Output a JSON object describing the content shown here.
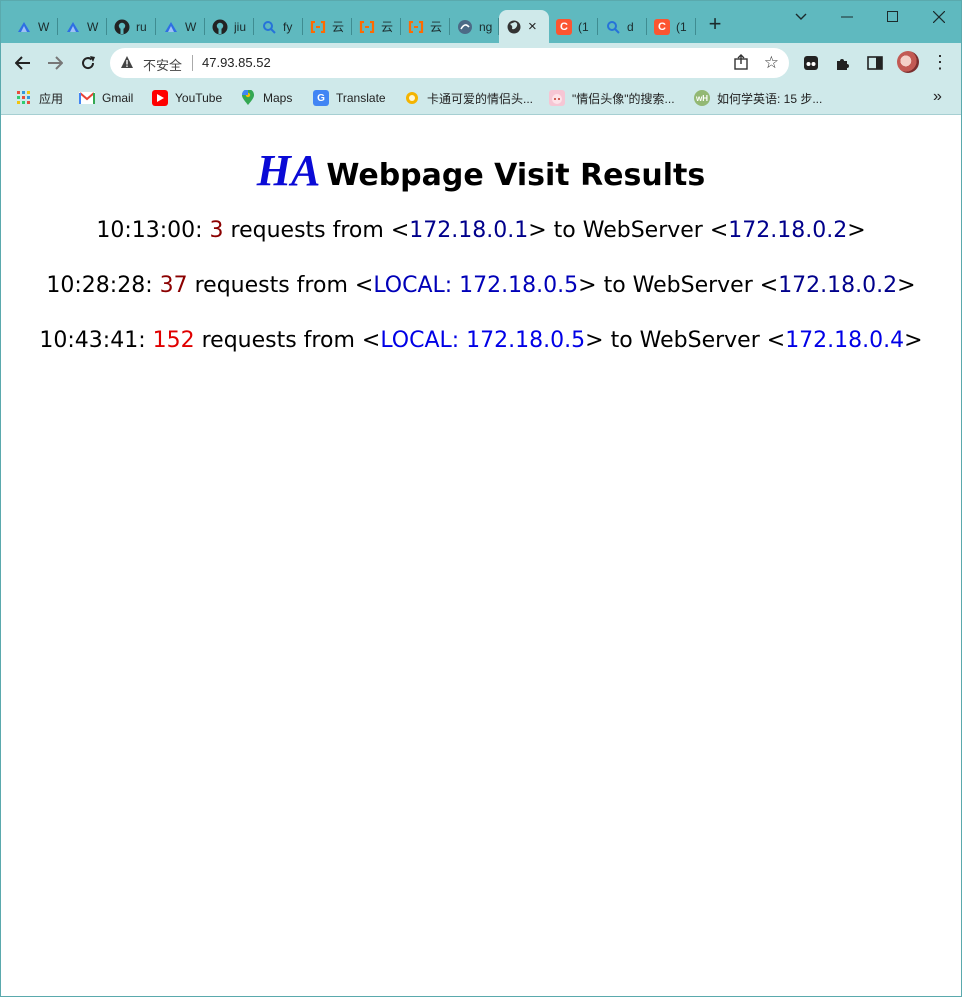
{
  "browser": {
    "tabs": [
      {
        "label": "W",
        "icon": "triangle-logo-icon",
        "color": "#2e6fe3"
      },
      {
        "label": "W",
        "icon": "triangle-logo-icon",
        "color": "#2e6fe3"
      },
      {
        "label": "ru",
        "icon": "github-icon",
        "color": "#222222"
      },
      {
        "label": "W",
        "icon": "triangle-logo-icon",
        "color": "#2e6fe3"
      },
      {
        "label": "jiu",
        "icon": "github-icon",
        "color": "#222222"
      },
      {
        "label": "fy",
        "icon": "search-icon",
        "color": "#2673d9"
      },
      {
        "label": "云",
        "icon": "aliyun-icon",
        "color": "#ff6a00"
      },
      {
        "label": "云",
        "icon": "aliyun-icon",
        "color": "#ff6a00"
      },
      {
        "label": "云",
        "icon": "aliyun-icon",
        "color": "#ff6a00"
      },
      {
        "label": "ng",
        "icon": "ng-icon",
        "color": "#4c6a86"
      },
      {
        "label": "",
        "icon": "globe-icon",
        "color": "#333333",
        "active": true,
        "close": "×"
      },
      {
        "label": "(1",
        "icon": "csdn-icon",
        "color": "#fc5531",
        "glyph": "C"
      },
      {
        "label": "d",
        "icon": "search-icon",
        "color": "#2673d9"
      },
      {
        "label": "(1",
        "icon": "csdn-icon",
        "color": "#fc5531",
        "glyph": "C"
      }
    ],
    "new_tab": "+",
    "address": {
      "security_label": "不安全",
      "url": "47.93.85.52"
    },
    "bookmarks": [
      {
        "label": "应用",
        "icon": "apps-grid-icon"
      },
      {
        "label": "Gmail",
        "icon": "gmail-icon"
      },
      {
        "label": "YouTube",
        "icon": "youtube-icon"
      },
      {
        "label": "Maps",
        "icon": "maps-icon"
      },
      {
        "label": "Translate",
        "icon": "translate-icon"
      },
      {
        "label": "卡通可爱的情侣头...",
        "icon": "sun-icon"
      },
      {
        "label": "\"情侣头像\"的搜索...",
        "icon": "anime-icon"
      },
      {
        "label": "如何学英语: 15 步...",
        "icon": "wikihow-icon"
      }
    ],
    "bookmarks_more": "»"
  },
  "page": {
    "title_logo": "HA",
    "title_text": "Webpage Visit Results",
    "entries": [
      {
        "time": "10:13:00: ",
        "count": "3",
        "mid": " requests from <",
        "source": "172.18.0.1",
        "to": "> to WebServer <",
        "server": "172.18.0.2",
        "end": ">"
      },
      {
        "time": "10:28:28: ",
        "count": "37",
        "mid": " requests from <",
        "source": "LOCAL: 172.18.0.5",
        "to": "> to WebServer <",
        "server": "172.18.0.2",
        "end": ">"
      },
      {
        "time": "10:43:41: ",
        "count": "152",
        "mid": " requests from <",
        "source": "LOCAL: 172.18.0.5",
        "to": "> to WebServer <",
        "server": "172.18.0.4",
        "end": ">"
      }
    ]
  }
}
